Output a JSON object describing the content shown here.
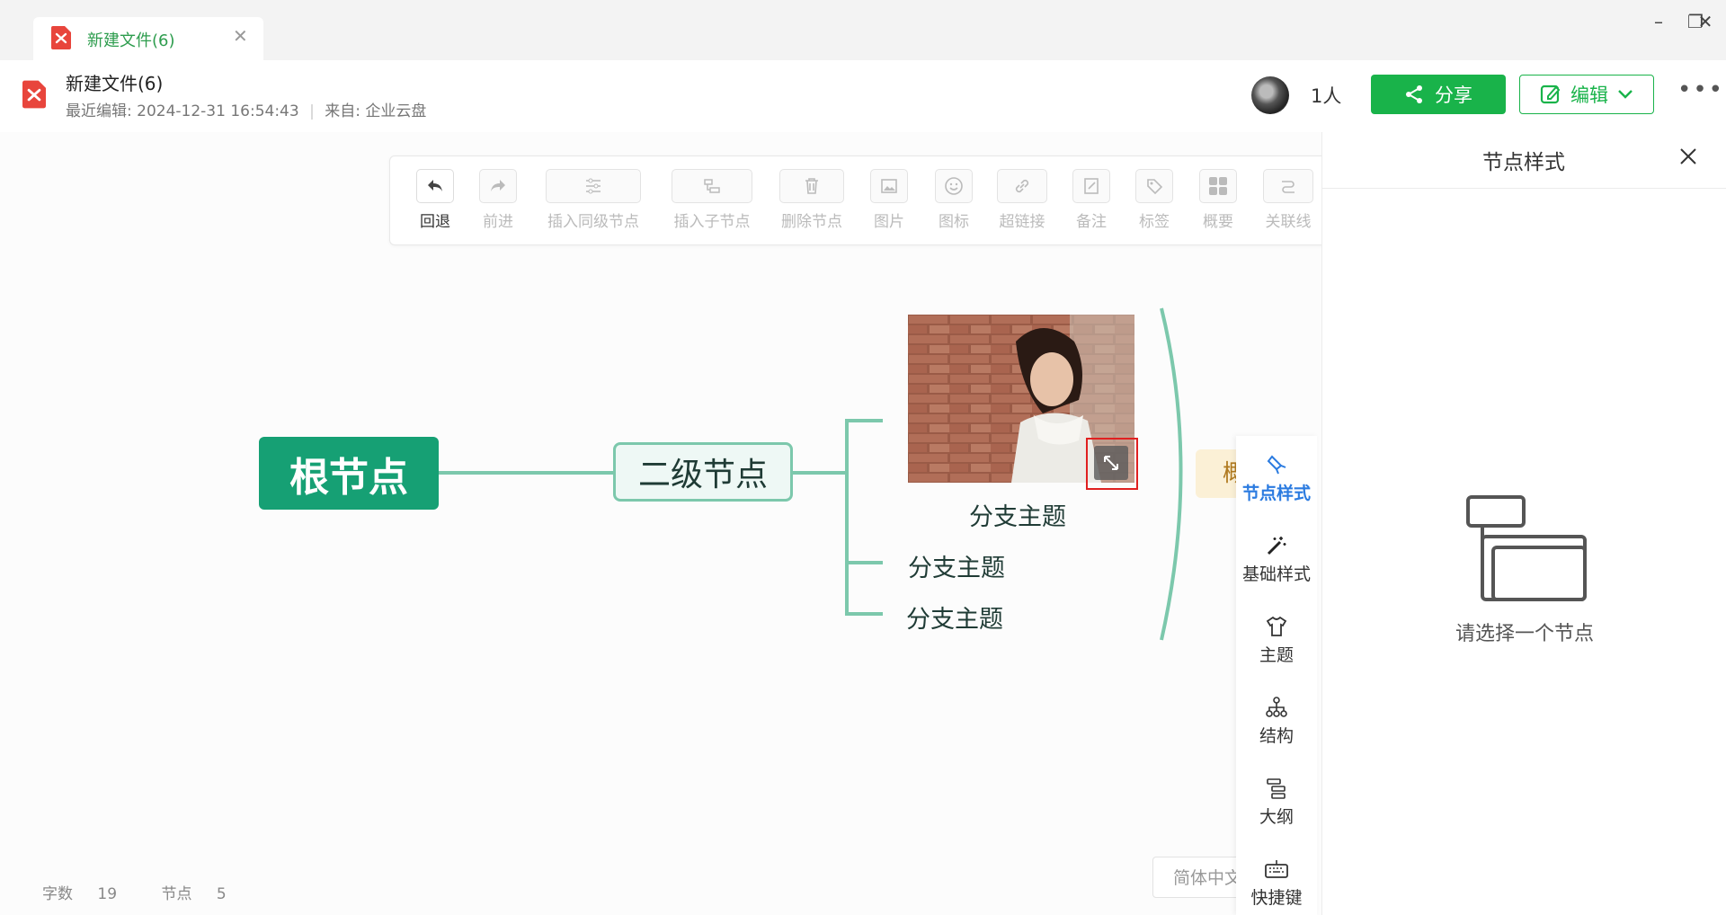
{
  "tab": {
    "title": "新建文件(6)"
  },
  "window": {
    "minimize": "–",
    "restore": "❐",
    "close": "✕"
  },
  "header": {
    "doc_title": "新建文件(6)",
    "last_edit_label": "最近编辑:",
    "last_edit_time": "2024-12-31 16:54:43",
    "source_label": "来自:",
    "source": "企业云盘",
    "people": "1人",
    "share_label": "分享",
    "edit_label": "编辑",
    "more": "•••"
  },
  "toolbar": [
    {
      "label": "回退",
      "icon": "undo-icon",
      "active": true
    },
    {
      "label": "前进",
      "icon": "redo-icon",
      "active": false
    },
    {
      "label": "插入同级节点",
      "icon": "insert-sibling-icon",
      "active": false
    },
    {
      "label": "插入子节点",
      "icon": "insert-child-icon",
      "active": false
    },
    {
      "label": "删除节点",
      "icon": "trash-icon",
      "active": false
    },
    {
      "label": "图片",
      "icon": "image-icon",
      "active": false
    },
    {
      "label": "图标",
      "icon": "emoji-icon",
      "active": false
    },
    {
      "label": "超链接",
      "icon": "link-icon",
      "active": false
    },
    {
      "label": "备注",
      "icon": "note-icon",
      "active": false
    },
    {
      "label": "标签",
      "icon": "tag-icon",
      "active": false
    },
    {
      "label": "概要",
      "icon": "summary-icon",
      "active": false
    },
    {
      "label": "关联线",
      "icon": "relation-line-icon",
      "active": false
    }
  ],
  "mindmap": {
    "root": "根节点",
    "level2": "二级节点",
    "branches": [
      "分支主题",
      "分支主题",
      "分支主题"
    ],
    "summary_stub": "概"
  },
  "status": {
    "words_label": "字数",
    "words": "19",
    "nodes_label": "节点",
    "nodes": "5"
  },
  "language": "简体中文",
  "side_strip": [
    {
      "label": "节点样式",
      "icon": "brush-icon",
      "active": true
    },
    {
      "label": "基础样式",
      "icon": "magic-wand-icon",
      "active": false
    },
    {
      "label": "主题",
      "icon": "shirt-icon",
      "active": false
    },
    {
      "label": "结构",
      "icon": "structure-icon",
      "active": false
    },
    {
      "label": "大纲",
      "icon": "outline-icon",
      "active": false
    },
    {
      "label": "快捷键",
      "icon": "keyboard-icon",
      "active": false
    }
  ],
  "panel": {
    "title": "节点样式",
    "empty_text": "请选择一个节点"
  },
  "colors": {
    "brand_green": "#19b34a",
    "root_green": "#16a074",
    "branch_line": "#7cc8ac",
    "selection_red": "#e02020"
  }
}
